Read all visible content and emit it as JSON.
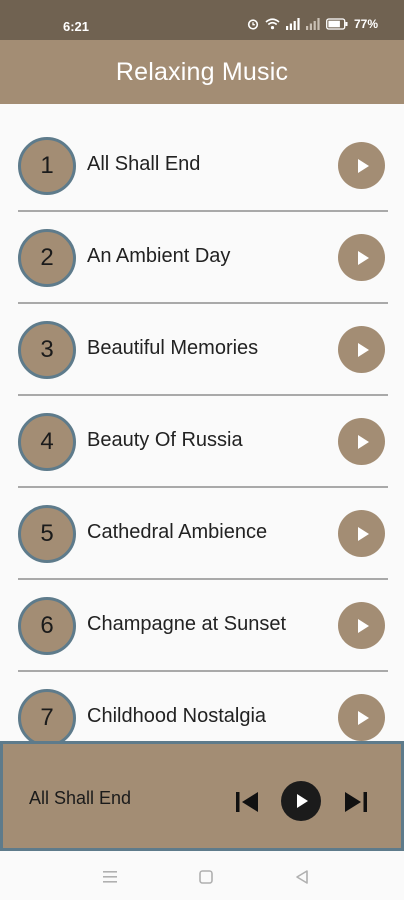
{
  "status_bar": {
    "time": "6:21",
    "battery": "77%",
    "icons": [
      "alarm-icon",
      "wifi-icon",
      "signal-icon",
      "signal-icon-2",
      "battery-icon"
    ]
  },
  "app_bar": {
    "title": "Relaxing Music"
  },
  "tracks": [
    {
      "number": "1",
      "title": "All Shall End"
    },
    {
      "number": "2",
      "title": "An Ambient Day"
    },
    {
      "number": "3",
      "title": "Beautiful Memories"
    },
    {
      "number": "4",
      "title": "Beauty Of Russia"
    },
    {
      "number": "5",
      "title": "Cathedral Ambience"
    },
    {
      "number": "6",
      "title": "Champagne at Sunset"
    },
    {
      "number": "7",
      "title": "Childhood Nostalgia"
    }
  ],
  "player": {
    "now_playing": "All Shall End",
    "controls": [
      "skip-previous-icon",
      "play-icon",
      "skip-next-icon"
    ]
  },
  "nav_bar": {
    "buttons": [
      "menu-icon",
      "home-icon",
      "back-icon"
    ]
  },
  "colors": {
    "status_bar": "#706251",
    "accent": "#a38d74",
    "ring": "#5e7b8b",
    "divider": "#a9a9a9",
    "background": "#fafafa"
  }
}
